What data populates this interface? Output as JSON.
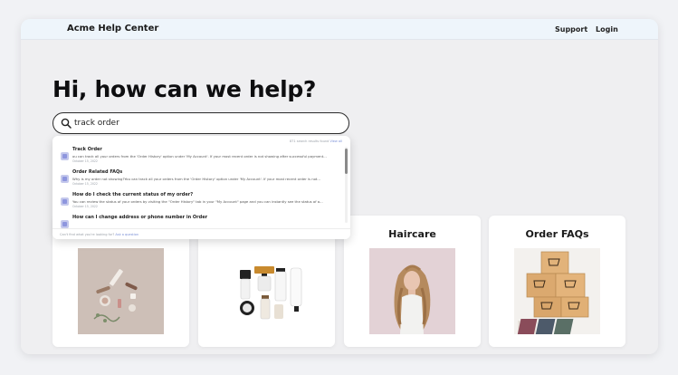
{
  "header": {
    "brand": "Acme Help Center",
    "nav": [
      {
        "label": "Support"
      },
      {
        "label": "Login"
      }
    ]
  },
  "hero": {
    "title": "Hi, how can we help?"
  },
  "search": {
    "value": "track order",
    "icon": "search-icon"
  },
  "dropdown": {
    "results_count": "871 search results found",
    "view_all": "View all",
    "results": [
      {
        "title": "Track Order",
        "snippet": "ou can track all your orders from the 'Order History' option under 'My Account'. If your most recent order is not showing after successful payment...",
        "date": "October 15, 2022"
      },
      {
        "title": "Order Related FAQs",
        "snippet": "Why is my order not showing?You can track all your orders from the 'Order History' option under 'My Account'. If your most recent order is not...",
        "date": "October 15, 2022"
      },
      {
        "title": "How do I check the current status of my order?",
        "snippet": "You can review the status of your orders by visiting the \"Order History\" tab in your \"My Account\" page and you can instantly see the status of a...",
        "date": "October 15, 2022"
      },
      {
        "title": "How can I change address or phone number in Order",
        "snippet": "",
        "date": ""
      }
    ],
    "footer_text": "Can't find what you're looking for?",
    "footer_link": "Ask a question"
  },
  "categories": [
    {
      "title": ""
    },
    {
      "title": ""
    },
    {
      "title": "Haircare"
    },
    {
      "title": "Order FAQs"
    }
  ],
  "colors": {
    "accent": "#7a8fd6",
    "result_icon": "#c4c8ec"
  }
}
